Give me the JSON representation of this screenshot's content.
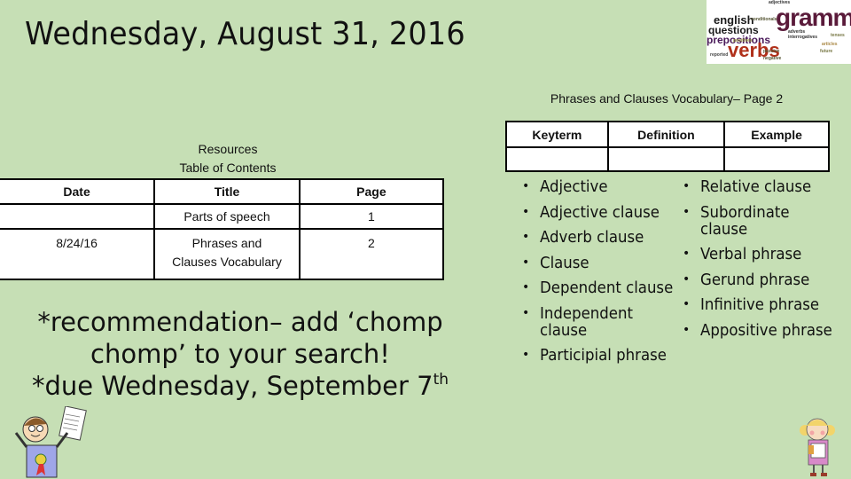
{
  "slide": {
    "title": "Wednesday, August 31, 2016",
    "background_color": "#c6dfb5"
  },
  "word_cloud": {
    "icon": "grammar-word-cloud-image",
    "words": [
      "grammar",
      "english",
      "questions",
      "prepositions",
      "verbs",
      "adjectives",
      "conditionals",
      "adverbs",
      "interrogatives",
      "reported",
      "positives",
      "passive",
      "negative",
      "tenses",
      "future",
      "articles"
    ]
  },
  "toc": {
    "caption_line1": "Resources",
    "caption_line2": "Table of Contents",
    "headers": [
      "Date",
      "Title",
      "Page"
    ],
    "rows": [
      {
        "date": "",
        "title": "Parts of speech",
        "page": "1"
      },
      {
        "date": "8/24/16",
        "title": "Phrases and Clauses Vocabulary",
        "page": "2"
      }
    ]
  },
  "vocab": {
    "caption": "Phrases and Clauses Vocabulary– Page 2",
    "headers": [
      "Keyterm",
      "Definition",
      "Example"
    ],
    "terms_left": [
      "Adjective",
      "Adjective clause",
      "Adverb clause",
      "Clause",
      "Dependent clause",
      "Independent clause",
      "Participial phrase"
    ],
    "terms_right": [
      "Relative clause",
      "Subordinate clause",
      "Verbal phrase",
      "Gerund phrase",
      "Infinitive phrase",
      "Appositive phrase"
    ]
  },
  "note": {
    "line1": "*recommendation– add ‘chomp",
    "line2": "chomp’ to your search!",
    "line3": "*due Wednesday, September 7",
    "line3_sup": "th"
  },
  "clipart": {
    "left": "boy-with-paper-and-ribbon-clipart",
    "right": "girl-holding-book-clipart"
  }
}
